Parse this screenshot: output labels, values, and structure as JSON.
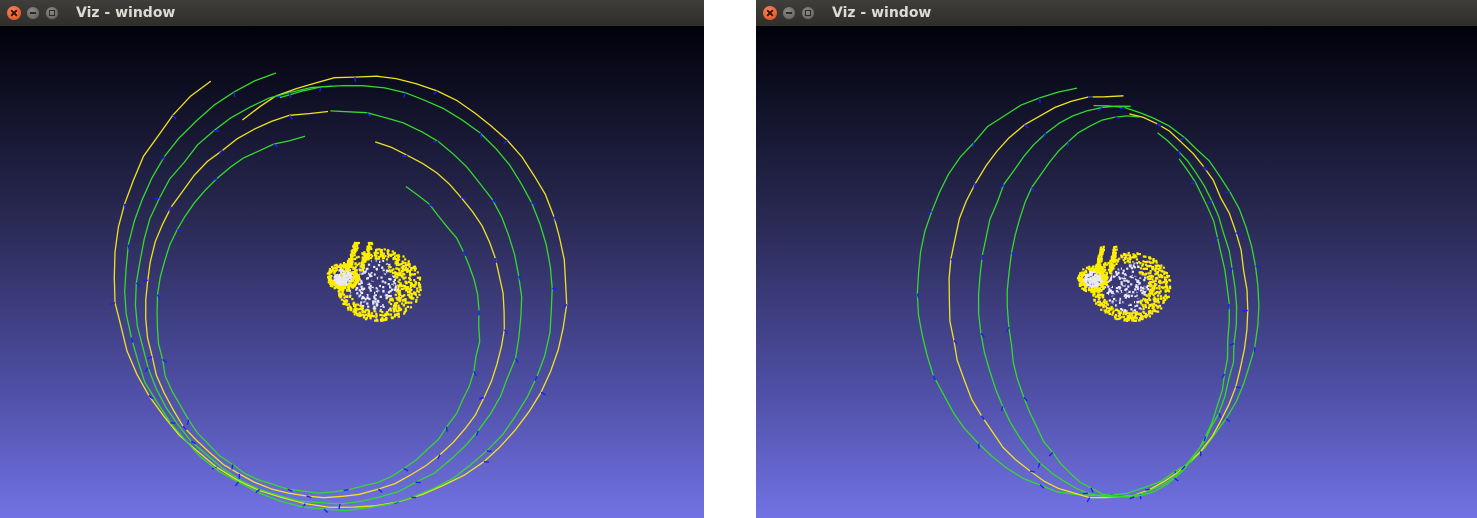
{
  "windows": [
    {
      "title": "Viz - window",
      "view": "top"
    },
    {
      "title": "Viz - window",
      "view": "side"
    }
  ],
  "colors": {
    "trajectory_yellow": "#f0e21f",
    "trajectory_green": "#34d92a",
    "camera_marker": "#1c1cff",
    "bunny_yellow": "#ffee00",
    "bunny_white": "#e8e8ff",
    "bg_top": "#01010a",
    "bg_bottom": "#7272e4"
  },
  "icons": [
    "close-icon",
    "minimize-icon",
    "maximize-icon"
  ]
}
